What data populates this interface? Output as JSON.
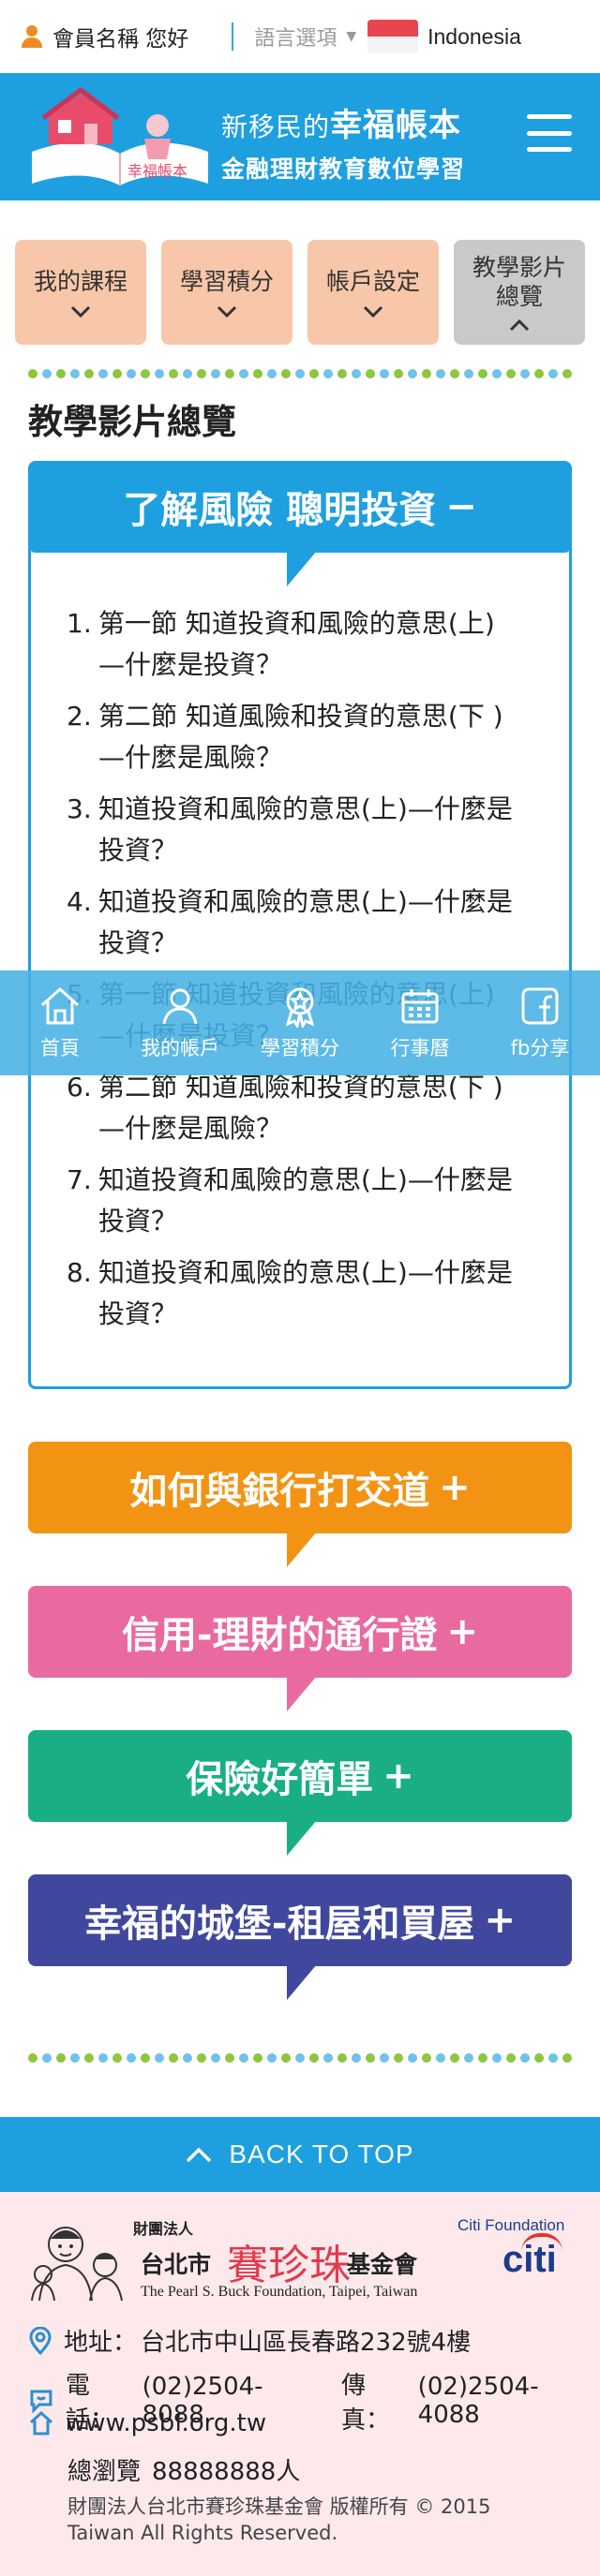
{
  "topbar": {
    "user_label": "會員名稱 您好",
    "language_label": "語言選項",
    "country": "Indonesia"
  },
  "header": {
    "title_small": "新移民的",
    "title_big": "幸福帳本",
    "subtitle": "金融理財教育數位學習",
    "logo_book_text": "幸福帳本"
  },
  "tabs": [
    {
      "label": "我的課程"
    },
    {
      "label": "學習積分"
    },
    {
      "label": "帳戶設定"
    },
    {
      "label": "教學影片\n總覽",
      "active": true
    }
  ],
  "page_title": "教學影片總覽",
  "accordion_open": {
    "title": "了解風險 聰明投資",
    "symbol": "−",
    "color": "#1d9fe0",
    "items": [
      {
        "num": "1.",
        "line1": "第一節 知道投資和風險的意思(上)",
        "line2": "—什麼是投資？"
      },
      {
        "num": "2.",
        "line1": "第二節 知道風險和投資的意思(下 )",
        "line2": "—什麼是風險？"
      },
      {
        "num": "3.",
        "line1": "知道投資和風險的意思(上)—什麼是",
        "line2": "投資？"
      },
      {
        "num": "4.",
        "line1": "知道投資和風險的意思(上)—什麼是",
        "line2": "投資？"
      },
      {
        "num": "5.",
        "line1": "第一節 知道投資和風險的意思(上)",
        "line2": "—什麼是投資？"
      },
      {
        "num": "6.",
        "line1": "第二節 知道風險和投資的意思(下 )",
        "line2": "—什麼是風險？"
      },
      {
        "num": "7.",
        "line1": "知道投資和風險的意思(上)—什麼是",
        "line2": "投資？"
      },
      {
        "num": "8.",
        "line1": "知道投資和風險的意思(上)—什麼是",
        "line2": "投資？"
      }
    ]
  },
  "accordions_closed": [
    {
      "title": "如何與銀行打交道",
      "symbol": "+",
      "color": "#f39313"
    },
    {
      "title": "信用-理財的通行證",
      "symbol": "+",
      "color": "#e86aa0"
    },
    {
      "title": "保險好簡單",
      "symbol": "+",
      "color": "#1aae86"
    },
    {
      "title": "幸福的城堡-租屋和買屋",
      "symbol": "+",
      "color": "#40489d"
    }
  ],
  "bottom_nav": [
    {
      "label": "首頁",
      "icon": "home-icon"
    },
    {
      "label": "我的帳戶",
      "icon": "user-icon"
    },
    {
      "label": "學習積分",
      "icon": "badge-icon"
    },
    {
      "label": "行事曆",
      "icon": "calendar-icon"
    },
    {
      "label": "fb分享",
      "icon": "facebook-icon"
    }
  ],
  "back_to_top": "BACK TO TOP",
  "footer": {
    "org_small": "財團法人",
    "org_city": "台北市",
    "org_name_art": "賽珍珠",
    "org_suffix": "基金會",
    "org_en": "The Pearl S. Buck Foundation, Taipei, Taiwan",
    "citi_foundation": "Citi Foundation",
    "citi": "citi",
    "address_label": "地址：",
    "address": "台北市中山區長春路232號4樓",
    "phone_label": "電話：",
    "phone": "(02)2504-8088",
    "fax_label": "傳真：",
    "fax": "(02)2504-4088",
    "website": "www.psbf.org.tw",
    "views_label": "總瀏覽",
    "views": "88888888人",
    "copyright1": "財團法人台北市賽珍珠基金會 版權所有 © 2015",
    "copyright2": "Taiwan All Rights Reserved."
  },
  "colors": {
    "primary": "#1d9fe0",
    "tab_bg": "#f8c6a9",
    "tab_active_bg": "#c9c9c9",
    "footer_bg": "#fde9ec",
    "dot_green": "#8dc63f",
    "dot_blue": "#6fc2ea"
  }
}
